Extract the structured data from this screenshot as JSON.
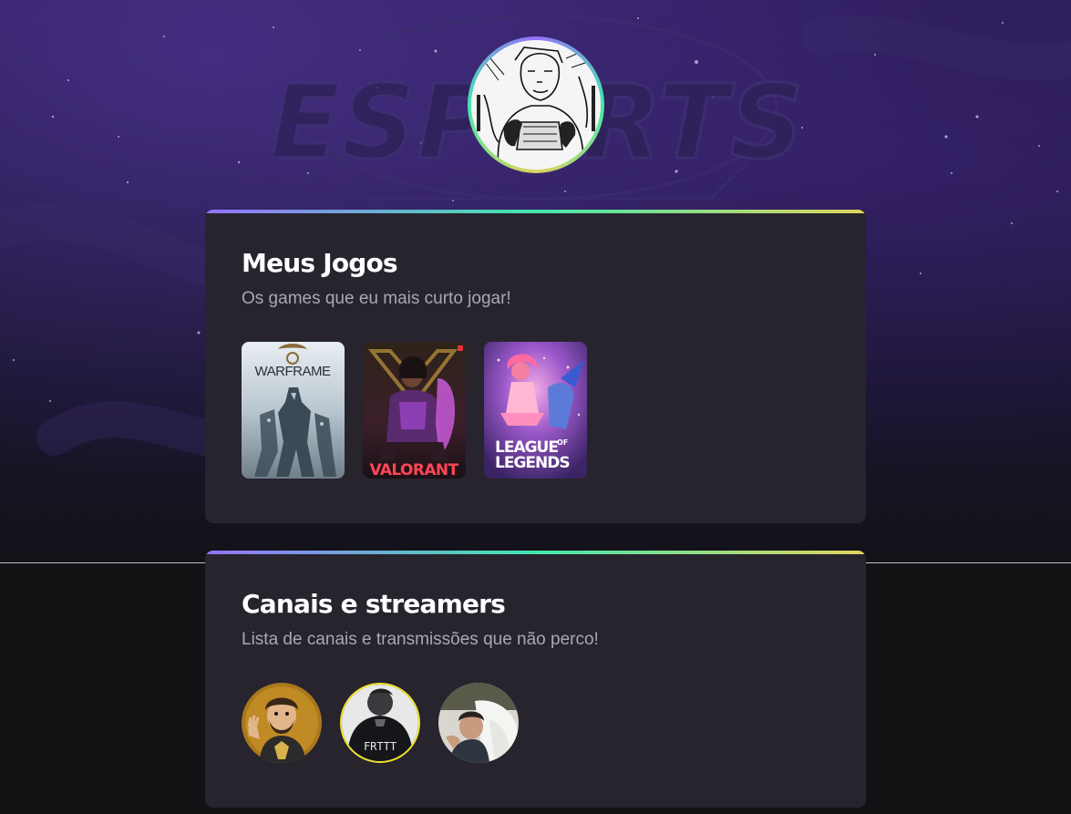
{
  "background": {
    "watermark_text": "ESPORTS",
    "gradient_colors": [
      "#2b1d55",
      "#231944",
      "#1a1530",
      "#131218"
    ]
  },
  "profile": {
    "avatar_icon": "manga-character-avatar",
    "ring_colors": [
      "#9572fc",
      "#43e7ad",
      "#e2d45c"
    ]
  },
  "games_section": {
    "title": "Meus Jogos",
    "subtitle": "Os games que eu mais curto jogar!",
    "games": [
      {
        "name": "WARFRAME",
        "icon": "warframe-cover"
      },
      {
        "name": "VALORANT",
        "icon": "valorant-cover"
      },
      {
        "name_line1": "LEAGUE",
        "name_of": "OF",
        "name_line2": "LEGENDS",
        "icon": "league-of-legends-cover"
      }
    ]
  },
  "channels_section": {
    "title": "Canais e streamers",
    "subtitle": "Lista de canais e transmissões que não perco!",
    "channels": [
      {
        "icon": "cartoon-streamer-avatar"
      },
      {
        "icon": "frttt-streamer-avatar",
        "jersey_text": "FRTTT",
        "ring_color": "#f2e32a"
      },
      {
        "icon": "photo-streamer-avatar"
      }
    ]
  },
  "colors": {
    "card_bg": "#27242e",
    "title": "#ffffff",
    "subtitle": "#a8a8b3",
    "accent_gradient": [
      "#9572fc",
      "#43e7ad",
      "#e2d45c"
    ]
  }
}
